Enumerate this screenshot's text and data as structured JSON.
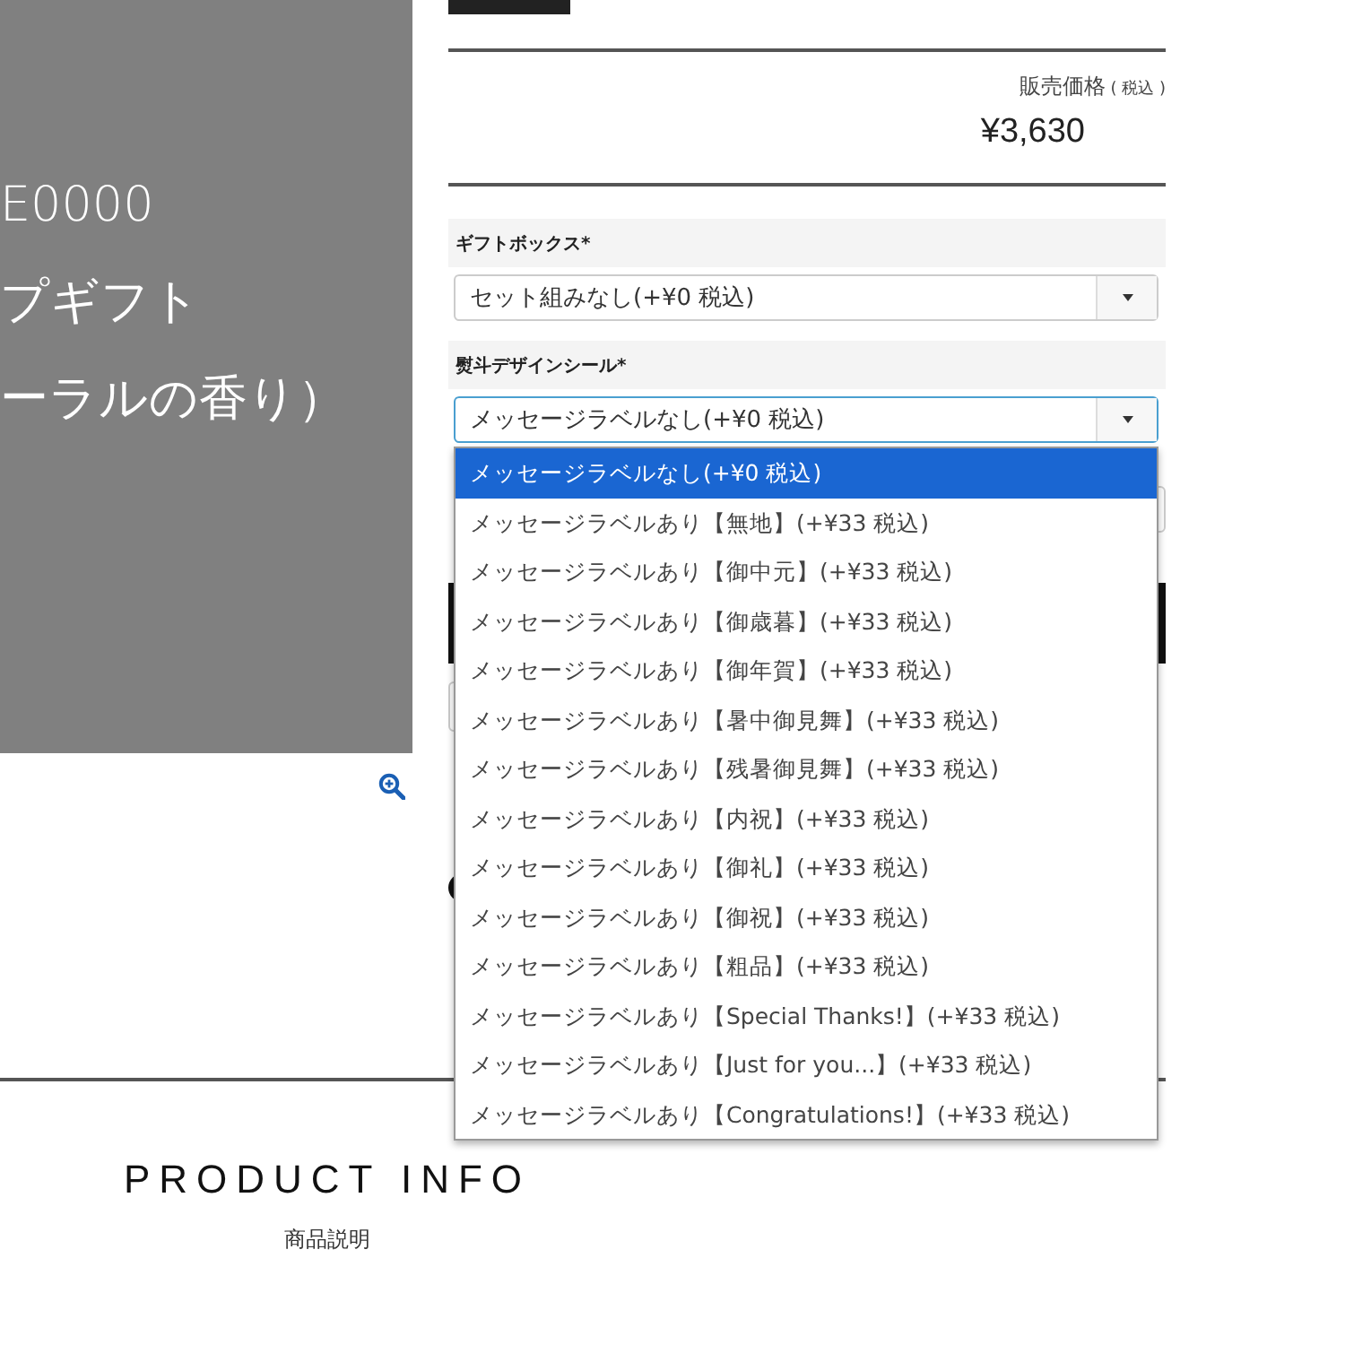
{
  "product_image": {
    "title_lines": [
      "E0000",
      "プギフト",
      "ーラルの香り）"
    ]
  },
  "price": {
    "label": "販売価格",
    "tax_note": "( 税込 )",
    "amount": "¥3,630"
  },
  "options": [
    {
      "label": "ギフトボックス*",
      "value": "セット組みなし(+¥0 税込)",
      "focused": false
    },
    {
      "label": "熨斗デザインシール*",
      "value": "メッセージラベルなし(+¥0 税込)",
      "focused": true
    }
  ],
  "dropdown": {
    "items": [
      {
        "label": "メッセージラベルなし(+¥0 税込)",
        "selected": true
      },
      {
        "label": "メッセージラベルあり【無地】(+¥33 税込)",
        "selected": false
      },
      {
        "label": "メッセージラベルあり【御中元】(+¥33 税込)",
        "selected": false
      },
      {
        "label": "メッセージラベルあり【御歳暮】(+¥33 税込)",
        "selected": false
      },
      {
        "label": "メッセージラベルあり【御年賀】(+¥33 税込)",
        "selected": false
      },
      {
        "label": "メッセージラベルあり【暑中御見舞】(+¥33 税込)",
        "selected": false
      },
      {
        "label": "メッセージラベルあり【残暑御見舞】(+¥33 税込)",
        "selected": false
      },
      {
        "label": "メッセージラベルあり【内祝】(+¥33 税込)",
        "selected": false
      },
      {
        "label": "メッセージラベルあり【御礼】(+¥33 税込)",
        "selected": false
      },
      {
        "label": "メッセージラベルあり【御祝】(+¥33 税込)",
        "selected": false
      },
      {
        "label": "メッセージラベルあり【粗品】(+¥33 税込)",
        "selected": false
      },
      {
        "label": "メッセージラベルあり【Special Thanks!】(+¥33 税込)",
        "selected": false
      },
      {
        "label": "メッセージラベルあり【Just for you...】(+¥33 税込)",
        "selected": false
      },
      {
        "label": "メッセージラベルあり【Congratulations!】(+¥33 税込)",
        "selected": false
      }
    ]
  },
  "section": {
    "title": "PRODUCT INFO",
    "subtitle": "商品説明"
  }
}
